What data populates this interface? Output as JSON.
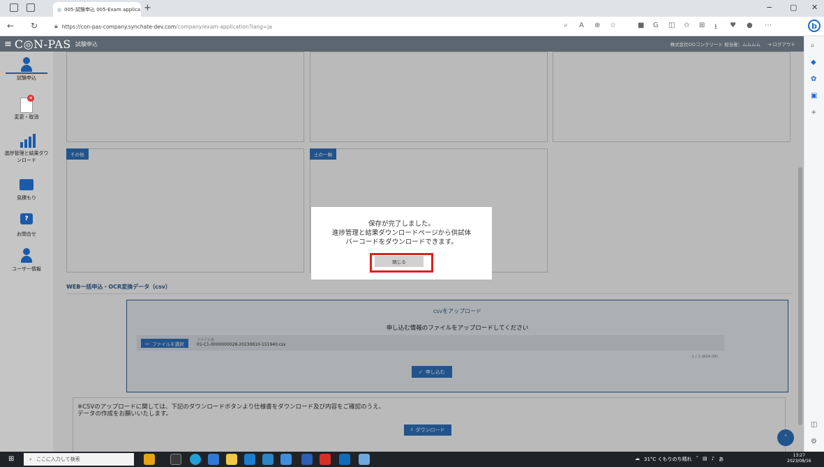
{
  "browser": {
    "tab_title": "005-試験申込 005-Exam applica",
    "url_main": "https://con-pas-company.synchate-dev.com",
    "url_path": "/company/exam-application?lang=ja"
  },
  "app": {
    "menu_icon": "≡",
    "logo": "C◎N-PAS",
    "section": "試験申込",
    "company_info": "株式会社OOコンクリート 担当者：ムムムム",
    "logout": "ログアウト"
  },
  "sidebar": {
    "items": [
      {
        "label": "試験申込",
        "icon": "person-icon"
      },
      {
        "label": "変更・取消",
        "icon": "document-cancel-icon"
      },
      {
        "label": "進捗管理と結果ダウンロード",
        "icon": "bar-chart-icon"
      },
      {
        "label": "見積もり",
        "icon": "envelope-icon"
      },
      {
        "label": "お問合せ",
        "icon": "question-bubble-icon"
      },
      {
        "label": "ユーザー情報",
        "icon": "user-icon"
      }
    ]
  },
  "boxes": {
    "tag_other": "その他",
    "tag_soil": "土の一軸"
  },
  "upload": {
    "section_title": "WEB一括申込・OCR変換データ（csv）",
    "title": "csvをアップロード",
    "instruction": "申し込む情報のファイルをアップロードしてください",
    "file_button": "ファイルを選択",
    "file_label": "ファイル名",
    "file_name": "01-C1-0000000028-20230810-151940.csv",
    "file_size": "1 / 1 (824.08)",
    "apply_button": "申し込む"
  },
  "note": {
    "line1": "※CSVのアップロードに関しては、下記のダウンロードボタンより仕様書をダウンロード及び内容をご確認のうえ、",
    "line2": "データの作成をお願いいたします。",
    "download_button": "ダウンロード"
  },
  "modal": {
    "line1": "保存が完了しました。",
    "line2": "進捗管理と結果ダウンロードページから供試体",
    "line3": "バーコードをダウンロードできます。",
    "close_button": "閉じる"
  },
  "taskbar": {
    "search_placeholder": "ここに入力して検索",
    "weather": "31°C くもりのち晴れ",
    "ime": "あ",
    "time": "13:27",
    "date": "2023/08/16"
  },
  "colors": {
    "accent": "#2f74c0",
    "header": "#5c6670",
    "highlight": "#e01e1e"
  }
}
